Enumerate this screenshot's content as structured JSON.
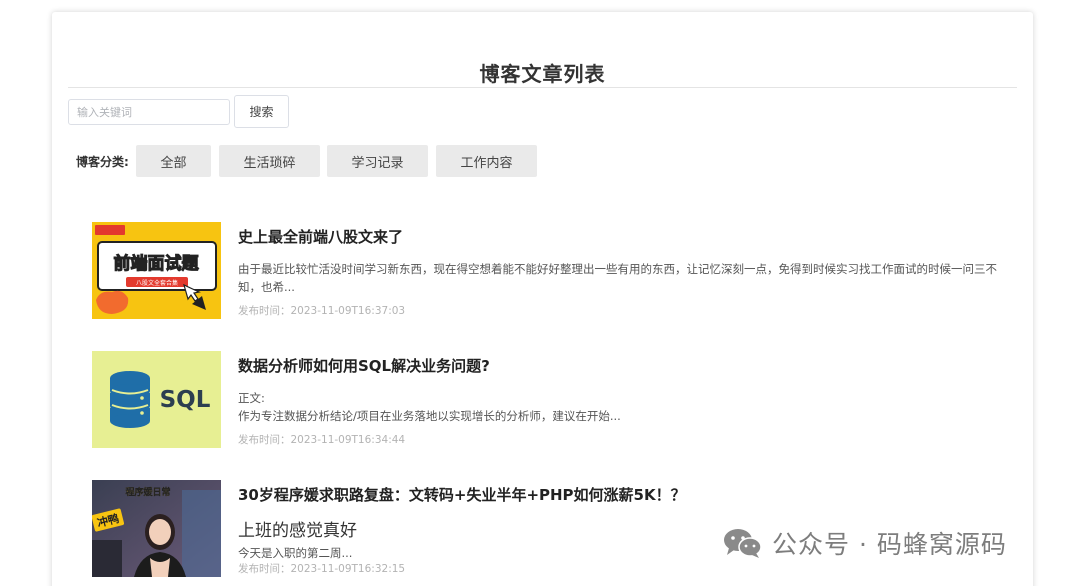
{
  "page": {
    "title": "博客文章列表"
  },
  "search": {
    "placeholder": "输入关键词",
    "button_label": "搜索"
  },
  "categories": {
    "label": "博客分类:",
    "items": [
      "全部",
      "生活琐碎",
      "学习记录",
      "工作内容"
    ]
  },
  "posts": [
    {
      "title": "史上最全前端八股文来了",
      "excerpt": "由于最近比较忙活没时间学习新东西，现在得空想着能不能好好整理出一些有用的东西，让记忆深刻一点，免得到时候实习找工作面试的时候一问三不知，也希...",
      "date": "发布时间：2023-11-09T16:37:03",
      "thumb": {
        "headline": "前端面试题",
        "tag": "八股文全套合集"
      }
    },
    {
      "title": "数据分析师如何用SQL解决业务问题?",
      "excerpt_intro": "正文:",
      "excerpt": "作为专注数据分析结论/项目在业务落地以实现增长的分析师，建议在开始...",
      "date": "发布时间：2023-11-09T16:34:44",
      "thumb": {
        "text": "SQL"
      }
    },
    {
      "title": "30岁程序媛求职路复盘：文转码+失业半年+PHP如何涨薪5K！？",
      "excerpt_heading": "上班的感觉真好",
      "excerpt": "今天是入职的第二周...",
      "date": "发布时间：2023-11-09T16:32:15",
      "thumb": {
        "caption": "程序媛日常",
        "sticker": "冲鸭"
      }
    }
  ],
  "watermark": {
    "text": "公众号 · 码蜂窝源码"
  },
  "colors": {
    "accent_yellow": "#f7c411",
    "sql_bg": "#e7ef93",
    "sql_blue": "#1f6ea8"
  }
}
